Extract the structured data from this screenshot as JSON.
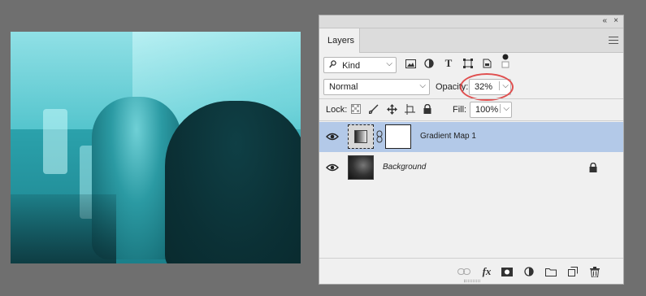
{
  "panel": {
    "collapse_icon": "«",
    "close_icon": "×",
    "tab_label": "Layers"
  },
  "filter": {
    "kind_label": "Kind",
    "icons": [
      "image-filter-icon",
      "adjustment-filter-icon",
      "type-filter-icon",
      "shape-filter-icon",
      "smart-object-filter-icon",
      "filter-toggle-icon"
    ]
  },
  "blend": {
    "mode": "Normal",
    "opacity_label": "Opacity:",
    "opacity_value": "32%"
  },
  "lock": {
    "label": "Lock:",
    "fill_label": "Fill:",
    "fill_value": "100%"
  },
  "layers": [
    {
      "name": "Gradient Map 1",
      "selected": true,
      "visible": true
    },
    {
      "name": "Background",
      "selected": false,
      "visible": true,
      "locked": true
    }
  ],
  "bottom_icons": [
    "link-layers-icon",
    "fx-icon",
    "layer-mask-icon",
    "adjustment-layer-icon",
    "new-group-icon",
    "new-layer-icon",
    "delete-layer-icon"
  ],
  "fx_label": "fx",
  "colors": {
    "selection": "#b3c9e8",
    "highlight_ellipse": "#e05050",
    "photo_tint": "#2aa0aa"
  }
}
